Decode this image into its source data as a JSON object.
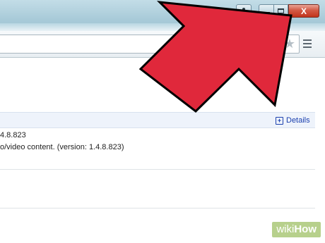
{
  "window": {
    "close_label": "X"
  },
  "plugin": {
    "version_fragment": "4.8.823",
    "description_fragment": "o/video content. (version: 1.4.8.823)",
    "details_label": "Details",
    "details_plus": "+"
  },
  "watermark": {
    "wiki": "wiki",
    "how": "How"
  },
  "colors": {
    "arrow_fill": "#e0283b",
    "arrow_stroke": "#000000",
    "close_button": "#c2341c",
    "link": "#1a3fae"
  },
  "icons": [
    "user-icon",
    "minimize-icon",
    "maximize-icon",
    "close-icon",
    "star-icon",
    "menu-icon",
    "expand-plus-icon"
  ]
}
